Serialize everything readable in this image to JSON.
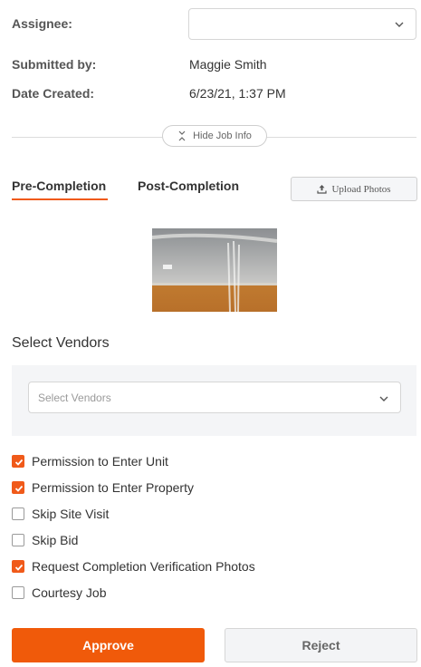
{
  "job_info": {
    "assignee_label": "Assignee:",
    "assignee_value": "",
    "submitted_by_label": "Submitted by:",
    "submitted_by_value": "Maggie Smith",
    "date_created_label": "Date Created:",
    "date_created_value": "6/23/21, 1:37 PM",
    "hide_job_info_label": "Hide Job Info"
  },
  "tabs": [
    {
      "label": "Pre-Completion",
      "active": true
    },
    {
      "label": "Post-Completion",
      "active": false
    }
  ],
  "upload_photos_label": "Upload Photos",
  "vendors": {
    "title": "Select Vendors",
    "placeholder": "Select Vendors"
  },
  "options": [
    {
      "label": "Permission to Enter Unit",
      "checked": true
    },
    {
      "label": "Permission to Enter Property",
      "checked": true
    },
    {
      "label": "Skip Site Visit",
      "checked": false
    },
    {
      "label": "Skip Bid",
      "checked": false
    },
    {
      "label": "Request Completion Verification Photos",
      "checked": true
    },
    {
      "label": "Courtesy Job",
      "checked": false
    }
  ],
  "actions": {
    "approve_label": "Approve",
    "reject_label": "Reject"
  },
  "colors": {
    "accent": "#f05a0a",
    "panel": "#f4f5f7"
  }
}
